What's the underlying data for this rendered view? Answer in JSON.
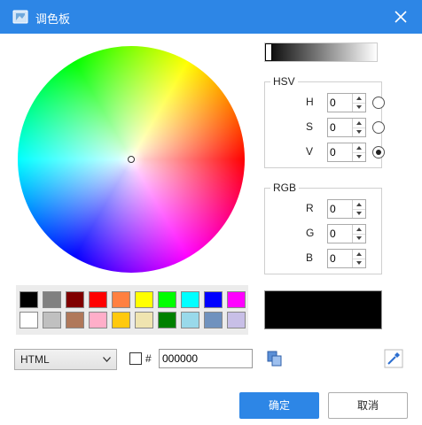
{
  "window": {
    "title": "调色板",
    "close_icon": "close-icon",
    "app_icon": "palette-app-icon"
  },
  "hsv": {
    "label": "HSV",
    "rows": [
      {
        "label": "H",
        "value": "0",
        "selected": false
      },
      {
        "label": "S",
        "value": "0",
        "selected": false
      },
      {
        "label": "V",
        "value": "0",
        "selected": true
      }
    ]
  },
  "rgb": {
    "label": "RGB",
    "rows": [
      {
        "label": "R",
        "value": "0"
      },
      {
        "label": "G",
        "value": "0"
      },
      {
        "label": "B",
        "value": "0"
      }
    ]
  },
  "luminance": {
    "level": 0
  },
  "palette": {
    "row1": [
      "#000000",
      "#808080",
      "#800000",
      "#ff0000",
      "#ff8040",
      "#ffff00",
      "#00ff00",
      "#00ffff",
      "#0000ff",
      "#ff00ff"
    ],
    "row2": [
      "#ffffff",
      "#c0c0c0",
      "#b0785a",
      "#ffaec9",
      "#ffc90e",
      "#efe4b0",
      "#008000",
      "#99d9ea",
      "#7092be",
      "#c8bfe7"
    ]
  },
  "preview_color": "#000000",
  "format": {
    "selected": "HTML"
  },
  "hex": {
    "hash_label": "#",
    "value": "000000"
  },
  "buttons": {
    "ok": "确定",
    "cancel": "取消"
  },
  "colors": {
    "accent": "#2d86e6"
  }
}
